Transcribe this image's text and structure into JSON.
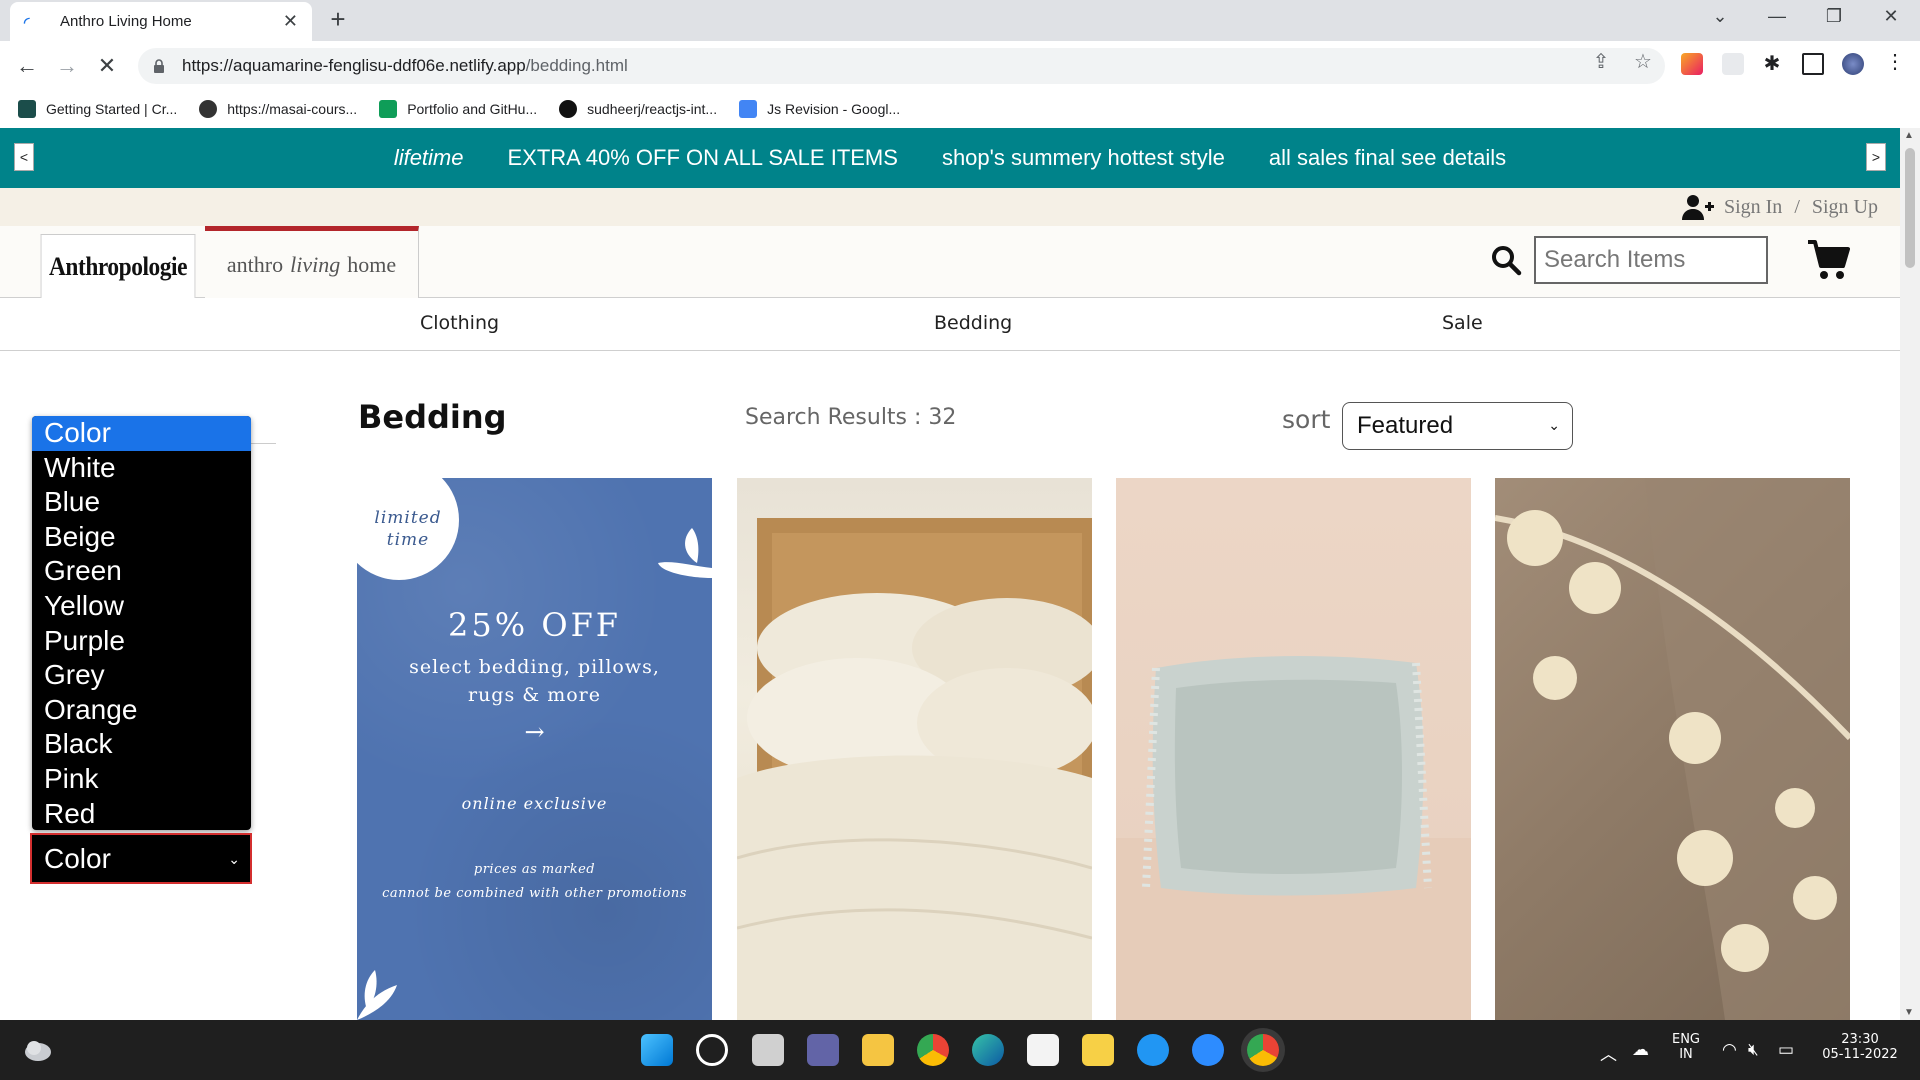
{
  "browser": {
    "tab_title": "Anthro Living Home",
    "tab_close": "✕",
    "new_tab": "+",
    "window_controls": [
      "⌄",
      "—",
      "❐",
      "✕"
    ],
    "url_host": "https://aquamarine-fenglisu-ddf06e.netlify.app",
    "url_path": "/bedding.html",
    "nav": {
      "back": "←",
      "forward": "→",
      "stop": "✕"
    },
    "bookmarks": [
      {
        "label": "Getting Started | Cr...",
        "icon": "app-icon",
        "color": "#1b4d4a"
      },
      {
        "label": "https://masai-cours...",
        "icon": "globe-icon",
        "color": "#333333"
      },
      {
        "label": "Portfolio and GitHu...",
        "icon": "sheets-icon",
        "color": "#0f9d58"
      },
      {
        "label": "sudheerj/reactjs-int...",
        "icon": "github-icon",
        "color": "#111111"
      },
      {
        "label": "Js Revision - Googl...",
        "icon": "docs-icon",
        "color": "#4285f4"
      }
    ]
  },
  "promo": {
    "prev": "<",
    "next": ">",
    "messages": [
      "lifetime",
      "EXTRA 40% OFF ON ALL SALE ITEMS",
      "shop's summery hottest style",
      "all sales final see details"
    ],
    "bg_color": "#00838a"
  },
  "account": {
    "sign_in": "Sign In",
    "separator": "/",
    "sign_up": "Sign Up"
  },
  "header": {
    "brand": "Anthropologie",
    "home_tab": {
      "w1": "anthro",
      "w2": "living",
      "w3": "home"
    },
    "search_placeholder": "Search Items",
    "accent_color": "#b3262b"
  },
  "nav": {
    "items": [
      "Clothing",
      "Bedding",
      "Sale"
    ]
  },
  "results": {
    "title": "Bedding",
    "count_text": "Search Results : 32",
    "sort_label": "sort",
    "sort_selected": "Featured"
  },
  "promo_card": {
    "limited_1": "limited",
    "limited_2": "time",
    "percent": "25% OFF",
    "sub_1": "select bedding, pillows,",
    "sub_2": "rugs & more",
    "arrow": "→",
    "online": "online exclusive",
    "fine_1": "prices as marked",
    "fine_2": "cannot be combined with other promotions"
  },
  "color_filter": {
    "selected": "Color",
    "options": [
      "Color",
      "White",
      "Blue",
      "Beige",
      "Green",
      "Yellow",
      "Purple",
      "Grey",
      "Orange",
      "Black",
      "Pink",
      "Red"
    ]
  },
  "taskbar": {
    "lang_1": "ENG",
    "lang_2": "IN",
    "time": "23:30",
    "date": "05-11-2022"
  }
}
